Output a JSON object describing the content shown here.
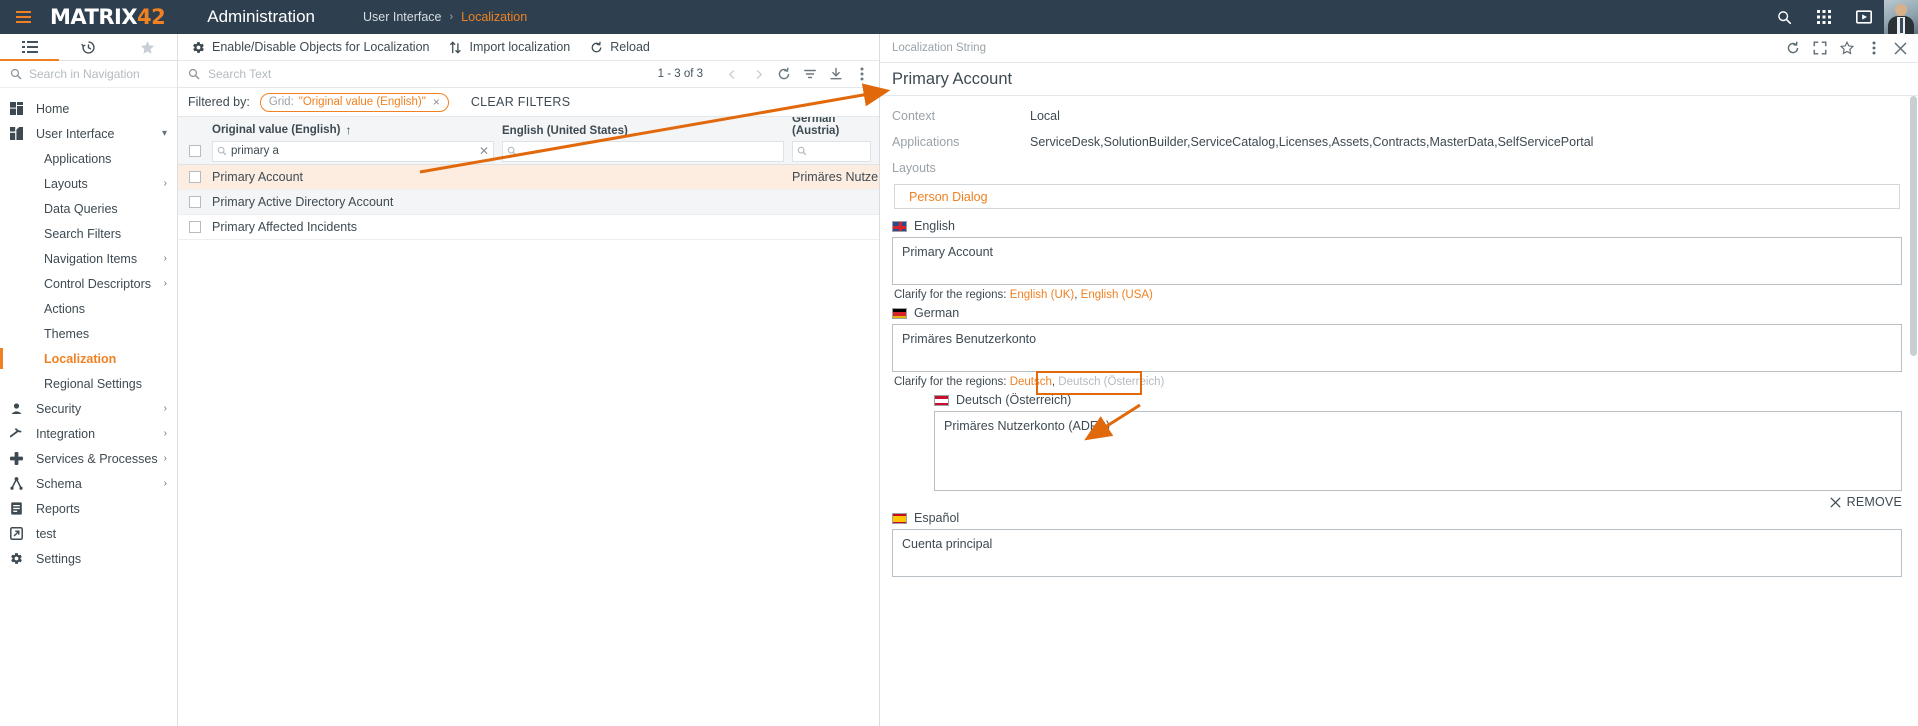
{
  "topbar": {
    "menu_icon": "hamburger-icon",
    "logo_text": "MATRIX",
    "logo_accent": "42",
    "app_title": "Administration",
    "breadcrumb": {
      "parent": "User Interface",
      "separator": "›",
      "current": "Localization"
    },
    "icons": [
      "search-icon",
      "apps-grid-icon",
      "presentation-icon"
    ],
    "accent_color": "#f08122",
    "bar_color": "#2e4050"
  },
  "sidebar": {
    "tabs": [
      {
        "name": "navigation-tab",
        "icon": "list-icon",
        "active": true
      },
      {
        "name": "history-tab",
        "icon": "history-clock-icon",
        "active": false
      },
      {
        "name": "favorites-tab",
        "icon": "star-icon",
        "active": false
      }
    ],
    "search": {
      "placeholder": "Search in Navigation",
      "value": ""
    },
    "items": [
      {
        "label": "Home",
        "icon": "home-dashboard-icon",
        "level": 0,
        "expandable": false,
        "active": false
      },
      {
        "label": "User Interface",
        "icon": "user-interface-icon",
        "level": 0,
        "expandable": true,
        "expanded": true,
        "active": false
      },
      {
        "label": "Applications",
        "level": 1,
        "active": false
      },
      {
        "label": "Layouts",
        "level": 1,
        "expandable": true,
        "active": false
      },
      {
        "label": "Data Queries",
        "level": 1,
        "active": false
      },
      {
        "label": "Search Filters",
        "level": 1,
        "active": false
      },
      {
        "label": "Navigation Items",
        "level": 1,
        "expandable": true,
        "active": false
      },
      {
        "label": "Control Descriptors",
        "level": 1,
        "expandable": true,
        "active": false
      },
      {
        "label": "Actions",
        "level": 1,
        "active": false
      },
      {
        "label": "Themes",
        "level": 1,
        "active": false
      },
      {
        "label": "Localization",
        "level": 1,
        "active": true
      },
      {
        "label": "Regional Settings",
        "level": 1,
        "active": false
      },
      {
        "label": "Security",
        "icon": "user-shield-icon",
        "level": 0,
        "expandable": true,
        "active": false
      },
      {
        "label": "Integration",
        "icon": "integration-arrow-icon",
        "level": 0,
        "expandable": true,
        "active": false
      },
      {
        "label": "Services & Processes",
        "icon": "services-cross-icon",
        "level": 0,
        "expandable": true,
        "active": false
      },
      {
        "label": "Schema",
        "icon": "schema-node-icon",
        "level": 0,
        "expandable": true,
        "active": false
      },
      {
        "label": "Reports",
        "icon": "reports-icon",
        "level": 0,
        "expandable": false,
        "active": false
      },
      {
        "label": "test",
        "icon": "test-external-icon",
        "level": 0,
        "expandable": false,
        "active": false
      },
      {
        "label": "Settings",
        "icon": "gear-icon",
        "level": 0,
        "expandable": false,
        "active": false
      }
    ]
  },
  "commandbar": {
    "commands": [
      {
        "label": "Enable/Disable Objects for Localization",
        "icon": "gear-icon"
      },
      {
        "label": "Import localization",
        "icon": "import-arrows-icon"
      },
      {
        "label": "Reload",
        "icon": "refresh-icon"
      }
    ]
  },
  "grid": {
    "search": {
      "placeholder": "Search Text",
      "value": ""
    },
    "pager": {
      "count_text": "1 - 3 of 3",
      "prev_icon": "chevron-left-icon",
      "next_icon": "chevron-right-icon",
      "refresh_icon": "refresh-icon",
      "filter_icon": "filter-icon",
      "export_icon": "download-icon",
      "more_icon": "more-vertical-icon"
    },
    "filter_bar": {
      "label": "Filtered by:",
      "chip_key": "Grid:",
      "chip_value": "\"Original value (English)\"",
      "chip_remove": "×",
      "clear_filters": "CLEAR FILTERS"
    },
    "columns": [
      {
        "label": "Original value (English)",
        "sorted": "asc",
        "sort_icon": "arrow-up-icon"
      },
      {
        "label": "English (United States)",
        "sorted": ""
      },
      {
        "label": "German (Austria)",
        "sorted": ""
      }
    ],
    "column_filters": [
      {
        "value": "primary a",
        "has_clear": true
      },
      {
        "value": "",
        "has_clear": false
      },
      {
        "value": "",
        "has_clear": false
      }
    ],
    "rows": [
      {
        "original": "Primary Account",
        "english_us": "",
        "german_at": "Primäres Nutzerk",
        "selected": true
      },
      {
        "original": "Primary Active Directory Account",
        "english_us": "",
        "german_at": "",
        "selected": false
      },
      {
        "original": "Primary Affected Incidents",
        "english_us": "",
        "german_at": "",
        "selected": false
      }
    ]
  },
  "detail": {
    "header_label": "Localization String",
    "header_icons": [
      "refresh-icon",
      "expand-icon",
      "star-icon",
      "more-vertical-icon",
      "close-icon"
    ],
    "title": "Primary Account",
    "fields": [
      {
        "key": "Context",
        "value": "Local"
      },
      {
        "key": "Applications",
        "value": "ServiceDesk,SolutionBuilder,ServiceCatalog,Licenses,Assets,Contracts,MasterData,SelfServicePortal"
      },
      {
        "key": "Layouts",
        "value": ""
      }
    ],
    "layout_link": "Person Dialog",
    "languages": [
      {
        "name": "English",
        "flag": "uk",
        "value": "Primary Account",
        "clarify_label": "Clarify for the regions:",
        "clarify_links": [
          "English (UK)",
          "English (USA)"
        ],
        "clarify_muted": []
      },
      {
        "name": "German",
        "flag": "de",
        "value": "Primäres Benutzerkonto",
        "clarify_label": "Clarify for the regions:",
        "clarify_links": [
          "Deutsch"
        ],
        "clarify_muted": [
          "Deutsch (Österreich)"
        ],
        "highlighted_muted": true
      }
    ],
    "region_block": {
      "name": "Deutsch (Österreich)",
      "flag": "at",
      "value": "Primäres Nutzerkonto (ADFS)",
      "remove_label": "REMOVE",
      "remove_icon": "close-icon"
    },
    "spanish": {
      "name": "Español",
      "flag": "es",
      "value": "Cuenta principal"
    }
  }
}
